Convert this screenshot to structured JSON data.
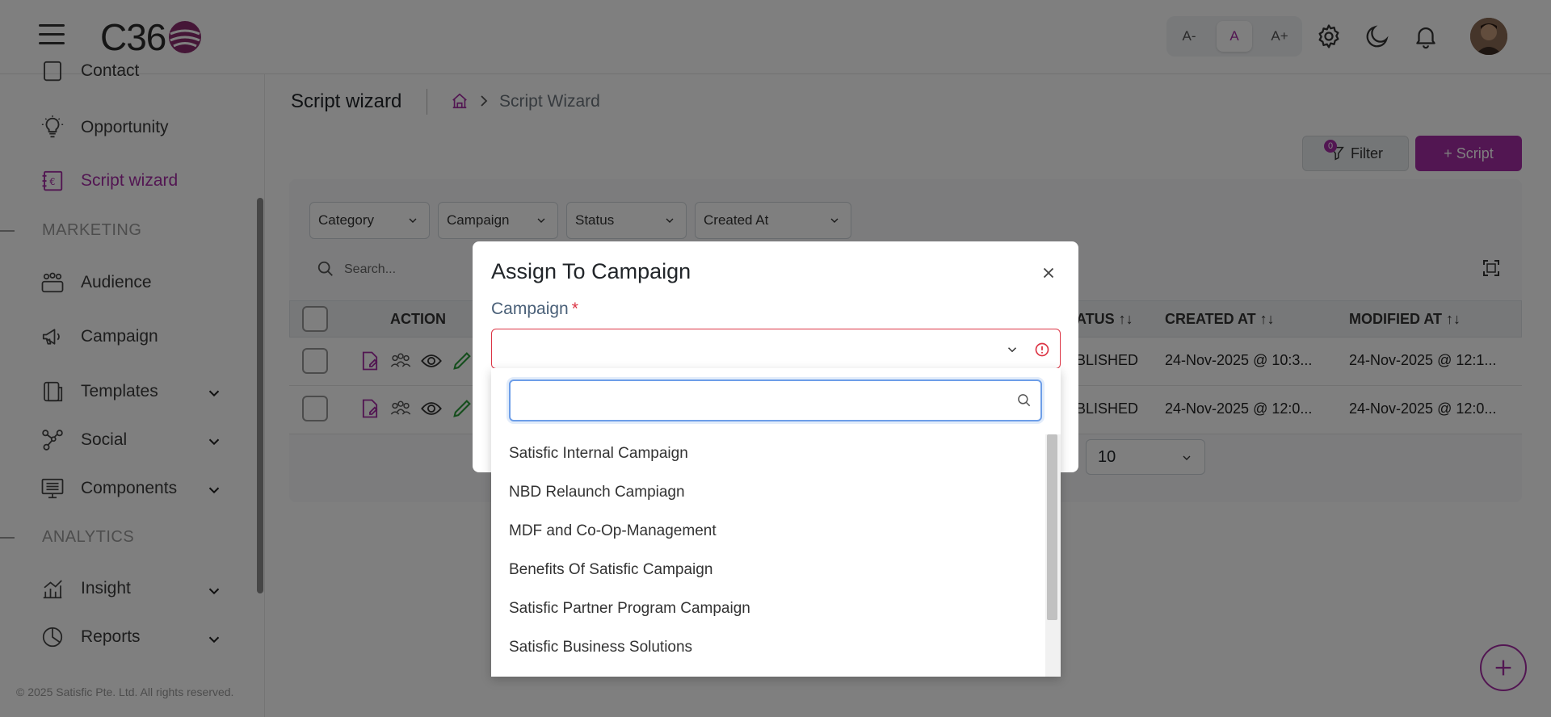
{
  "header": {
    "font_small": "A-",
    "font_normal": "A",
    "font_large": "A+"
  },
  "sidebar": {
    "items": [
      {
        "label": "Contact"
      },
      {
        "label": "Opportunity"
      },
      {
        "label": "Script wizard"
      },
      {
        "label": "Audience"
      },
      {
        "label": "Campaign"
      },
      {
        "label": "Templates"
      },
      {
        "label": "Social"
      },
      {
        "label": "Components"
      },
      {
        "label": "Insight"
      },
      {
        "label": "Reports"
      }
    ],
    "sections": {
      "marketing": "MARKETING",
      "analytics": "ANALYTICS"
    },
    "footer": "© 2025 Satisfic Pte. Ltd. All rights reserved."
  },
  "main": {
    "page_title": "Script wizard",
    "breadcrumb": "Script Wizard",
    "filter_button": "Filter",
    "filter_count": "0",
    "add_script_button": "+ Script",
    "filters": [
      "Category",
      "Campaign",
      "Status",
      "Created At"
    ],
    "search_placeholder": "Search...",
    "table": {
      "headers": {
        "action": "ACTION",
        "status": "ATUS ↑↓",
        "created_at": "CREATED AT ↑↓",
        "modified_at": "MODIFIED AT ↑↓"
      },
      "rows": [
        {
          "status": "BLISHED",
          "created_at": "24-Nov-2025 @ 10:3...",
          "modified_at": "24-Nov-2025 @ 12:1..."
        },
        {
          "status": "BLISHED",
          "created_at": "24-Nov-2025 @ 12:0...",
          "modified_at": "24-Nov-2025 @ 12:0..."
        }
      ]
    },
    "page_size": "10"
  },
  "modal": {
    "title": "Assign To Campaign",
    "campaign_label": "Campaign",
    "required_mark": "*",
    "search_value": "",
    "options": [
      "Satisfic Internal Campaign",
      "NBD Relaunch Campiagn",
      "MDF and Co-Op-Management",
      "Benefits Of Satisfic Campaign",
      "Satisfic Partner Program Campaign",
      "Satisfic Business Solutions"
    ]
  },
  "colors": {
    "brand": "#a52ca5",
    "error": "#dc3545",
    "focus": "#6d9ee8"
  }
}
